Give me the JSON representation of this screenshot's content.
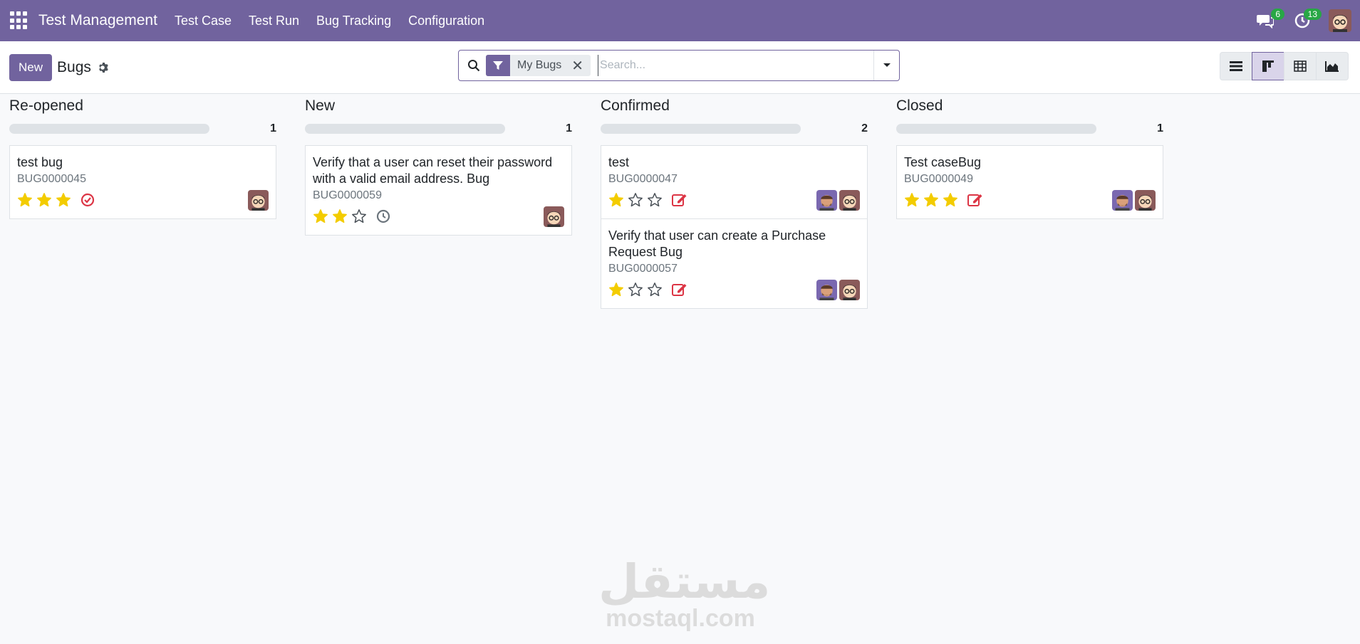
{
  "navbar": {
    "brand": "Test Management",
    "menu": [
      "Test Case",
      "Test Run",
      "Bug Tracking",
      "Configuration"
    ],
    "messages_count": "6",
    "activities_count": "13"
  },
  "control_panel": {
    "new_label": "New",
    "breadcrumb": "Bugs",
    "search": {
      "facet": "My Bugs",
      "placeholder": "Search..."
    }
  },
  "colors": {
    "brand": "#71639e",
    "star": "#f3cc00",
    "danger": "#dc3545",
    "badge": "#28a745"
  },
  "columns": [
    {
      "title": "Re-opened",
      "count": "1",
      "cards": [
        {
          "title": "test bug",
          "ref": "BUG0000045",
          "stars": 3,
          "state": "check-circle-icon",
          "avatars": [
            "user-b"
          ]
        }
      ]
    },
    {
      "title": "New",
      "count": "1",
      "cards": [
        {
          "title": "Verify that a user can reset their password with a valid email address. Bug",
          "ref": "BUG0000059",
          "stars": 2,
          "state": "clock-icon",
          "avatars": [
            "user-b"
          ]
        }
      ]
    },
    {
      "title": "Confirmed",
      "count": "2",
      "cards": [
        {
          "title": "test",
          "ref": "BUG0000047",
          "stars": 1,
          "state": "edit-icon",
          "avatars": [
            "user-a",
            "user-b"
          ]
        },
        {
          "title": "Verify that user can create a Purchase Request Bug",
          "ref": "BUG0000057",
          "stars": 1,
          "state": "edit-icon",
          "avatars": [
            "user-a",
            "user-b"
          ]
        }
      ]
    },
    {
      "title": "Closed",
      "count": "1",
      "cards": [
        {
          "title": "Test caseBug",
          "ref": "BUG0000049",
          "stars": 3,
          "state": "edit-icon",
          "avatars": [
            "user-a",
            "user-b"
          ]
        }
      ]
    }
  ],
  "watermark": {
    "arabic": "مستقل",
    "latin": "mostaql.com"
  }
}
